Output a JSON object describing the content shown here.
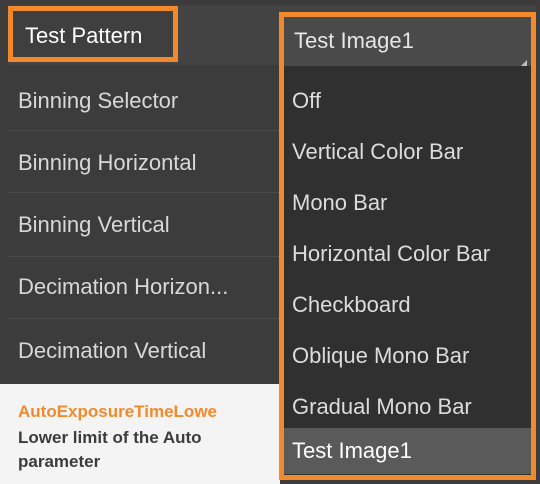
{
  "header": {
    "label": "Test Pattern",
    "selected_value": "Test Image1"
  },
  "properties": [
    {
      "label": "Binning Selector"
    },
    {
      "label": "Binning Horizontal"
    },
    {
      "label": "Binning Vertical"
    },
    {
      "label": "Decimation Horizon..."
    },
    {
      "label": "Decimation Vertical"
    }
  ],
  "description": {
    "title": "AutoExposureTimeLowe",
    "line1": "Lower limit of the Auto",
    "line2": "parameter"
  },
  "dropdown": {
    "options": [
      {
        "label": "Off"
      },
      {
        "label": "Vertical Color Bar"
      },
      {
        "label": "Mono Bar"
      },
      {
        "label": "Horizontal Color Bar"
      },
      {
        "label": "Checkboard"
      },
      {
        "label": "Oblique Mono Bar"
      },
      {
        "label": "Gradual Mono Bar"
      },
      {
        "label": "Test Image1"
      }
    ],
    "selected": "Test Image1"
  },
  "colors": {
    "highlight": "#f28a2c",
    "panel": "#3c3c3c"
  }
}
